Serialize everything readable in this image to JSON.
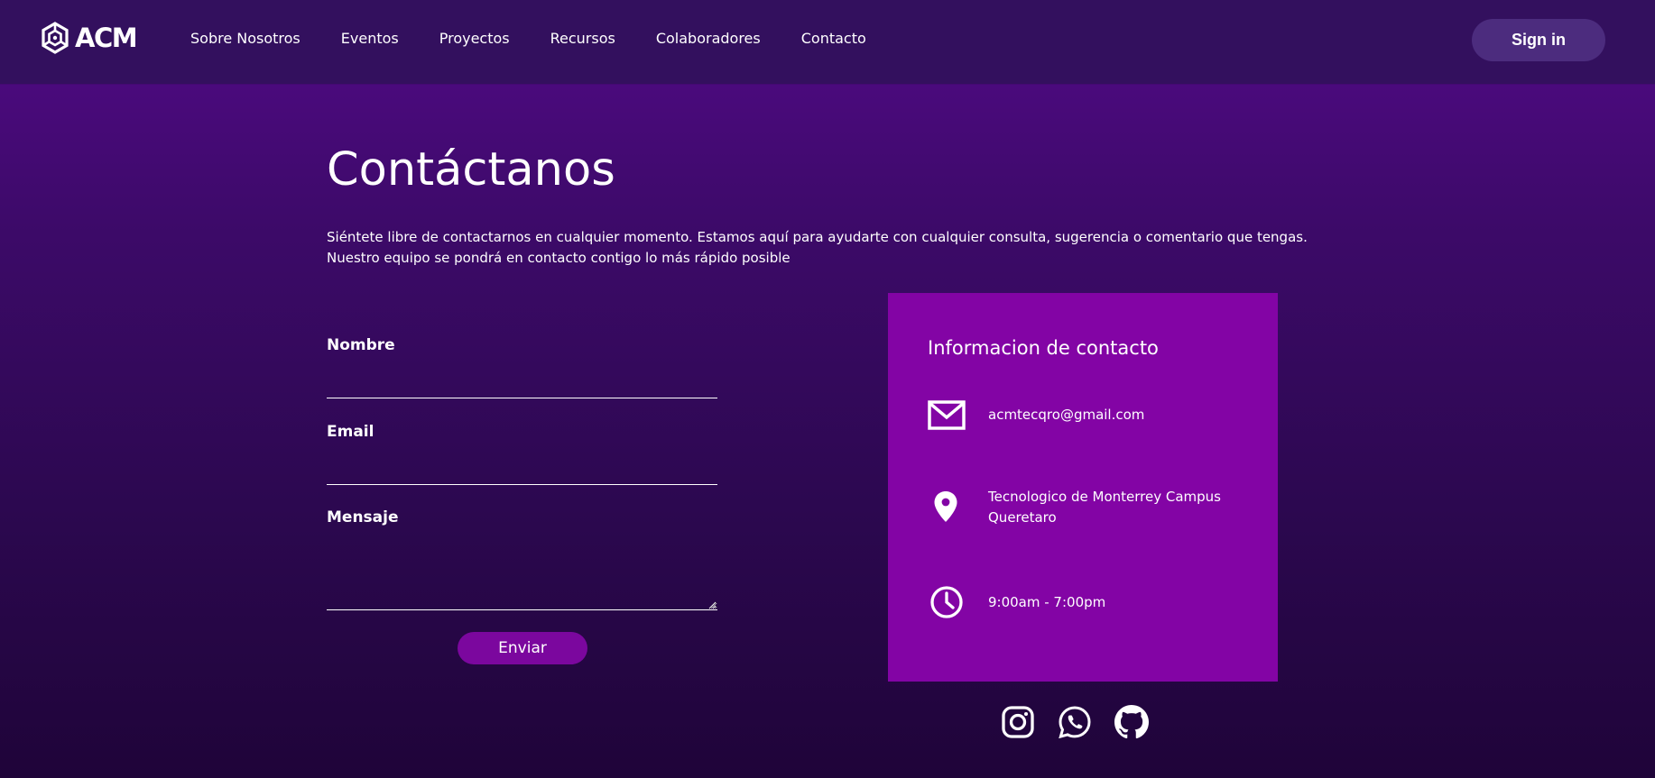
{
  "header": {
    "logo_text": "ACM",
    "nav": [
      {
        "label": "Sobre Nosotros"
      },
      {
        "label": "Eventos"
      },
      {
        "label": "Proyectos"
      },
      {
        "label": "Recursos"
      },
      {
        "label": "Colaboradores"
      },
      {
        "label": "Contacto"
      }
    ],
    "signin_label": "Sign in"
  },
  "main": {
    "title": "Contáctanos",
    "description_lines": [
      "Siéntete libre de contactarnos en cualquier momento. Estamos aquí para ayudarte con cualquier consulta, sugerencia o comentario que tengas.",
      "Nuestro equipo se pondrá en contacto contigo lo más rápido posible"
    ],
    "form": {
      "name_label": "Nombre",
      "name_value": "",
      "email_label": "Email",
      "email_value": "",
      "message_label": "Mensaje",
      "message_value": "",
      "submit_label": "Enviar"
    },
    "contact_card": {
      "title": "Informacion de contacto",
      "email": "acmtecqro@gmail.com",
      "address": "Tecnologico de Monterrey Campus Queretaro",
      "hours": "9:00am - 7:00pm",
      "icons": [
        "mail-icon",
        "location-pin-icon",
        "clock-icon"
      ]
    },
    "social": [
      "instagram-icon",
      "whatsapp-icon",
      "github-icon"
    ]
  },
  "colors": {
    "header_bg": "#33105e",
    "page_top": "#4a0a7c",
    "page_bottom": "#1f0439",
    "card_bg": "#8304a5",
    "button_bg": "#7b079e",
    "signin_bg": "#4c2c7e"
  }
}
